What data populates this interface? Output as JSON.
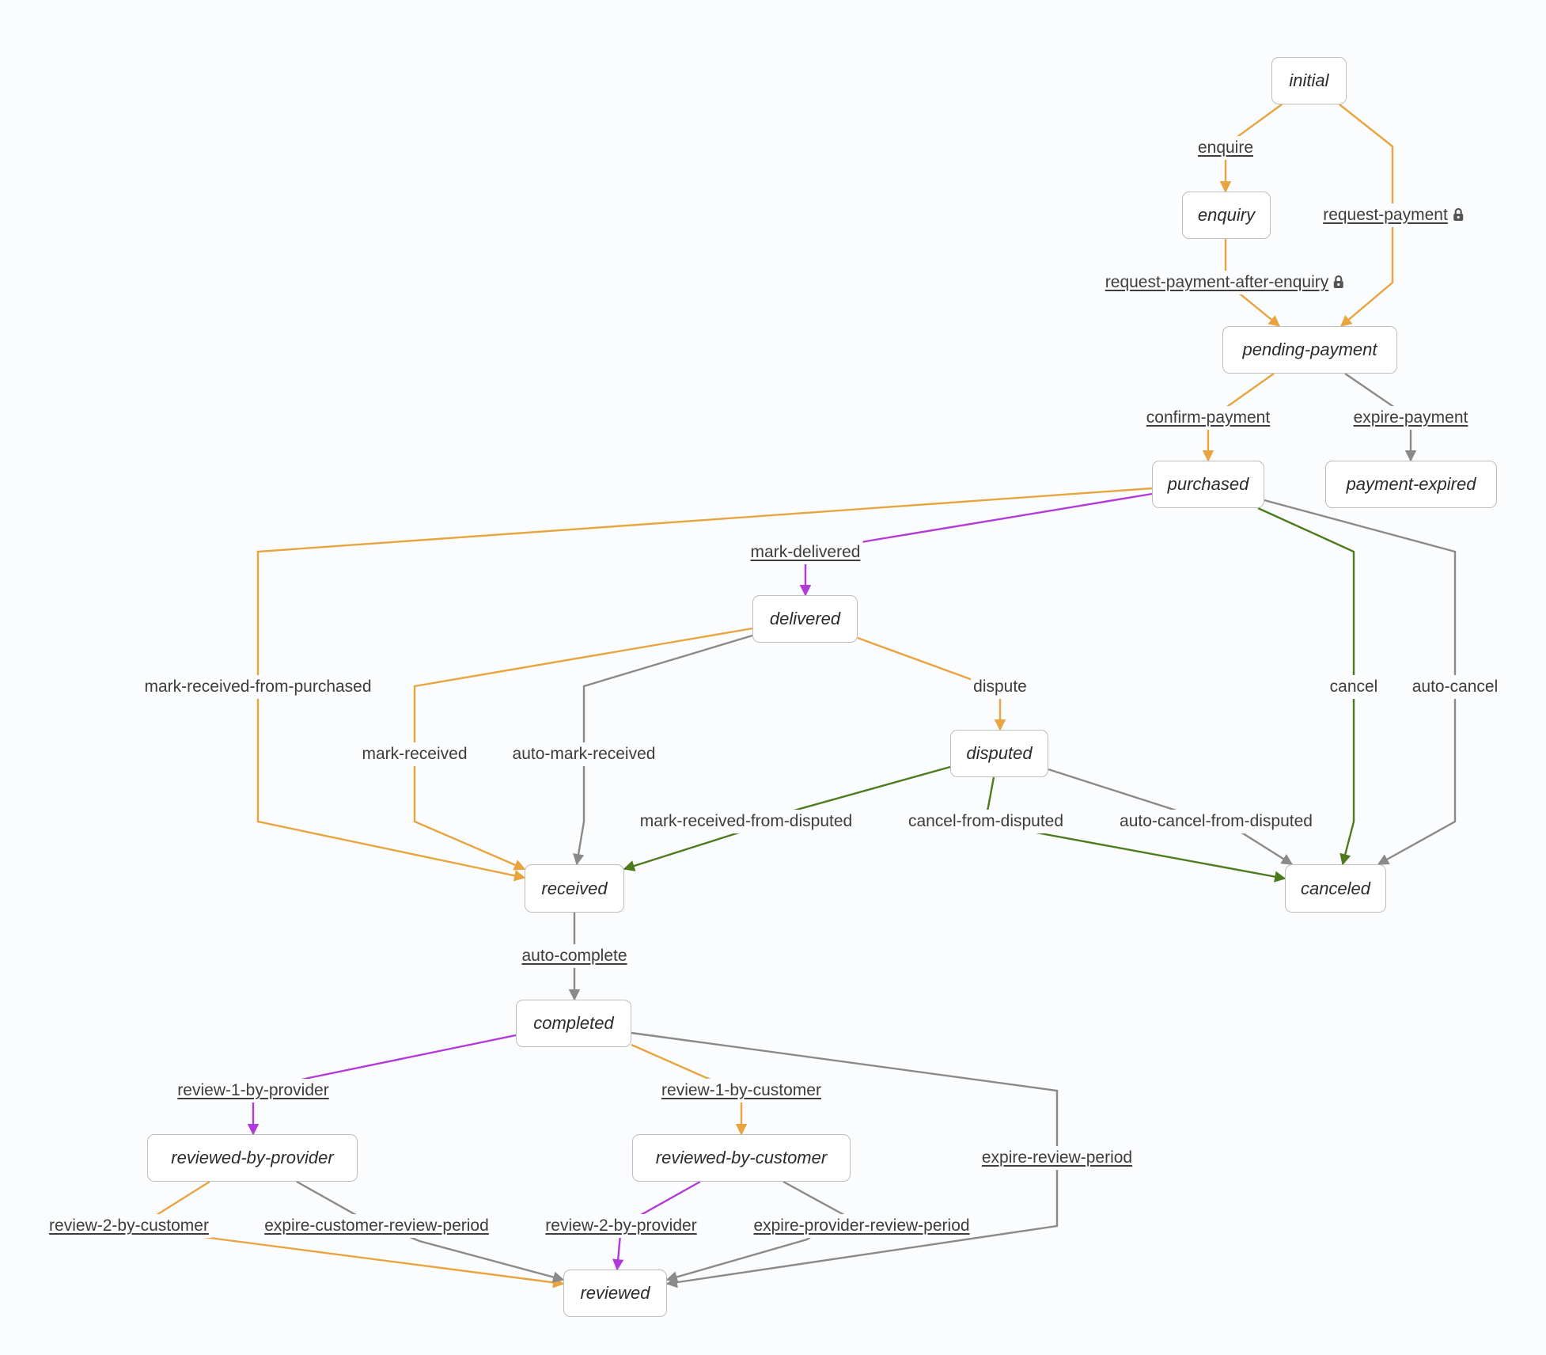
{
  "colors": {
    "orange": "#e8a43f",
    "purple": "#b23ad8",
    "green": "#4d7a1d",
    "gray": "#8a8a8a",
    "node_border": "#bdbdbd",
    "text": "#3d3d3d"
  },
  "nodes": [
    {
      "id": "initial",
      "label": "initial"
    },
    {
      "id": "enquiry",
      "label": "enquiry"
    },
    {
      "id": "pending-payment",
      "label": "pending-payment"
    },
    {
      "id": "purchased",
      "label": "purchased"
    },
    {
      "id": "payment-expired",
      "label": "payment-expired"
    },
    {
      "id": "delivered",
      "label": "delivered"
    },
    {
      "id": "disputed",
      "label": "disputed"
    },
    {
      "id": "received",
      "label": "received"
    },
    {
      "id": "canceled",
      "label": "canceled"
    },
    {
      "id": "completed",
      "label": "completed"
    },
    {
      "id": "reviewed-by-provider",
      "label": "reviewed-by-provider"
    },
    {
      "id": "reviewed-by-customer",
      "label": "reviewed-by-customer"
    },
    {
      "id": "reviewed",
      "label": "reviewed"
    }
  ],
  "transitions": [
    {
      "id": "enquire",
      "label": "enquire",
      "from": "initial",
      "to": "enquiry",
      "color": "orange",
      "actionable": true,
      "locked": false
    },
    {
      "id": "request-payment",
      "label": "request-payment",
      "from": "initial",
      "to": "pending-payment",
      "color": "orange",
      "actionable": true,
      "locked": true
    },
    {
      "id": "request-payment-after-enquiry",
      "label": "request-payment-after-enquiry",
      "from": "enquiry",
      "to": "pending-payment",
      "color": "orange",
      "actionable": true,
      "locked": true
    },
    {
      "id": "confirm-payment",
      "label": "confirm-payment",
      "from": "pending-payment",
      "to": "purchased",
      "color": "orange",
      "actionable": true,
      "locked": false
    },
    {
      "id": "expire-payment",
      "label": "expire-payment",
      "from": "pending-payment",
      "to": "payment-expired",
      "color": "gray",
      "actionable": true,
      "locked": false
    },
    {
      "id": "mark-delivered",
      "label": "mark-delivered",
      "from": "purchased",
      "to": "delivered",
      "color": "purple",
      "actionable": true,
      "locked": false
    },
    {
      "id": "mark-received-from-purchased",
      "label": "mark-received-from-purchased",
      "from": "purchased",
      "to": "received",
      "color": "orange",
      "actionable": false,
      "locked": false
    },
    {
      "id": "cancel",
      "label": "cancel",
      "from": "purchased",
      "to": "canceled",
      "color": "green",
      "actionable": false,
      "locked": false
    },
    {
      "id": "auto-cancel",
      "label": "auto-cancel",
      "from": "purchased",
      "to": "canceled",
      "color": "gray",
      "actionable": false,
      "locked": false
    },
    {
      "id": "mark-received",
      "label": "mark-received",
      "from": "delivered",
      "to": "received",
      "color": "orange",
      "actionable": false,
      "locked": false
    },
    {
      "id": "auto-mark-received",
      "label": "auto-mark-received",
      "from": "delivered",
      "to": "received",
      "color": "gray",
      "actionable": false,
      "locked": false
    },
    {
      "id": "dispute",
      "label": "dispute",
      "from": "delivered",
      "to": "disputed",
      "color": "orange",
      "actionable": false,
      "locked": false
    },
    {
      "id": "mark-received-from-disputed",
      "label": "mark-received-from-disputed",
      "from": "disputed",
      "to": "received",
      "color": "green",
      "actionable": false,
      "locked": false
    },
    {
      "id": "cancel-from-disputed",
      "label": "cancel-from-disputed",
      "from": "disputed",
      "to": "canceled",
      "color": "green",
      "actionable": false,
      "locked": false
    },
    {
      "id": "auto-cancel-from-disputed",
      "label": "auto-cancel-from-disputed",
      "from": "disputed",
      "to": "canceled",
      "color": "gray",
      "actionable": false,
      "locked": false
    },
    {
      "id": "auto-complete",
      "label": "auto-complete",
      "from": "received",
      "to": "completed",
      "color": "gray",
      "actionable": true,
      "locked": false
    },
    {
      "id": "review-1-by-provider",
      "label": "review-1-by-provider",
      "from": "completed",
      "to": "reviewed-by-provider",
      "color": "purple",
      "actionable": true,
      "locked": false
    },
    {
      "id": "review-1-by-customer",
      "label": "review-1-by-customer",
      "from": "completed",
      "to": "reviewed-by-customer",
      "color": "orange",
      "actionable": true,
      "locked": false
    },
    {
      "id": "expire-review-period",
      "label": "expire-review-period",
      "from": "completed",
      "to": "reviewed",
      "color": "gray",
      "actionable": true,
      "locked": false
    },
    {
      "id": "review-2-by-customer",
      "label": "review-2-by-customer",
      "from": "reviewed-by-provider",
      "to": "reviewed",
      "color": "orange",
      "actionable": true,
      "locked": false
    },
    {
      "id": "expire-customer-review-period",
      "label": "expire-customer-review-period",
      "from": "reviewed-by-provider",
      "to": "reviewed",
      "color": "gray",
      "actionable": true,
      "locked": false
    },
    {
      "id": "review-2-by-provider",
      "label": "review-2-by-provider",
      "from": "reviewed-by-customer",
      "to": "reviewed",
      "color": "purple",
      "actionable": true,
      "locked": false
    },
    {
      "id": "expire-provider-review-period",
      "label": "expire-provider-review-period",
      "from": "reviewed-by-customer",
      "to": "reviewed",
      "color": "gray",
      "actionable": true,
      "locked": false
    }
  ]
}
